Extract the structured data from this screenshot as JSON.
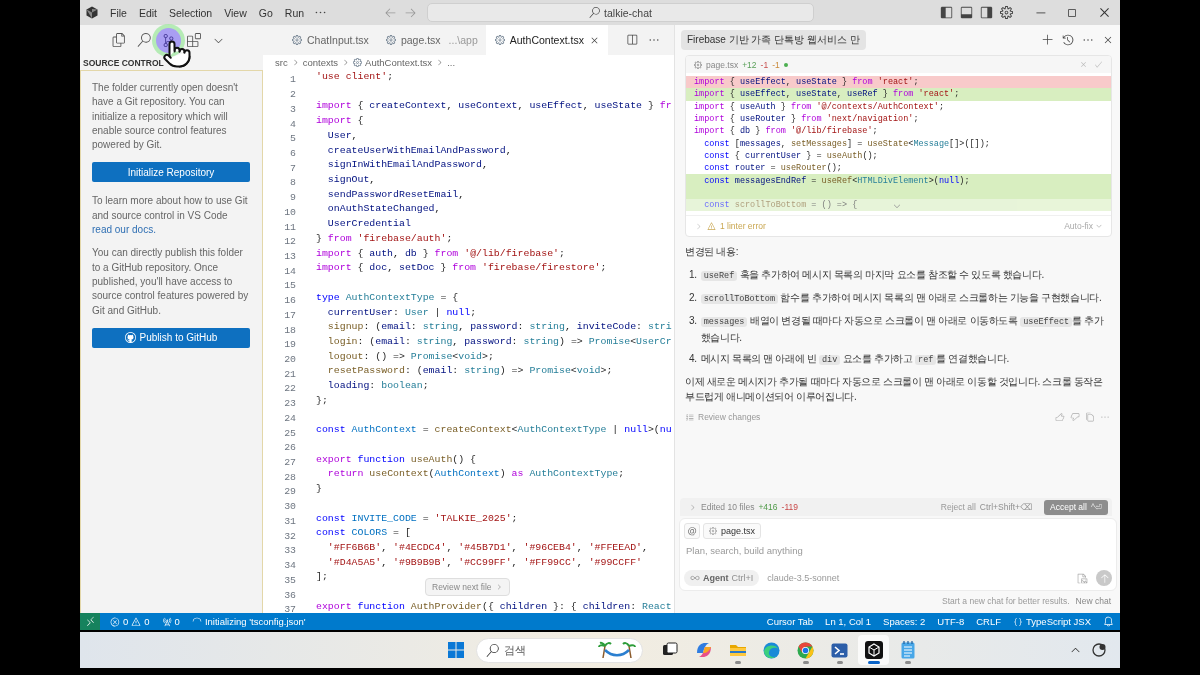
{
  "title_bar": {
    "menus": [
      "File",
      "Edit",
      "Selection",
      "View",
      "Go",
      "Run"
    ],
    "search": "talkie-chat"
  },
  "sidebar": {
    "views": [
      {
        "kind": "explorer",
        "selected": false
      },
      {
        "kind": "search",
        "selected": false
      },
      {
        "kind": "source_control",
        "selected": true
      },
      {
        "kind": "extensions",
        "selected": false
      },
      {
        "kind": "more",
        "selected": false
      }
    ],
    "title": "SOURCE CONTROL",
    "intro": "The folder currently open doesn't have a Git repository. You can initialize a repository which will enable source control features powered by Git.",
    "init_button": "Initialize Repository",
    "docs_text": "To learn more about how to use Git and source control in VS Code",
    "docs_link": "read our docs.",
    "publish_text": "You can directly publish this folder to a GitHub repository. Once published, you'll have access to source control features powered by Git and GitHub.",
    "publish_button": "Publish to GitHub"
  },
  "editor": {
    "tabs": [
      {
        "label": "ChatInput.tsx",
        "selected": false
      },
      {
        "label": "page.tsx",
        "detail": "...\\app",
        "selected": false
      },
      {
        "label": "AuthContext.tsx",
        "selected": true
      }
    ],
    "breadcrumb": [
      "src",
      "contexts",
      "AuthContext.tsx",
      "..."
    ],
    "lines": [
      {
        "number": "1",
        "tokens": [
          {
            "kind": "string",
            "text": "'use client'"
          },
          {
            "kind": "plain",
            "text": ";"
          }
        ]
      },
      {
        "number": "2"
      },
      {
        "number": "3",
        "tokens": [
          {
            "kind": "control",
            "text": "import"
          },
          {
            "kind": "plain",
            "text": " { "
          },
          {
            "kind": "variable",
            "text": "createContext"
          },
          {
            "kind": "plain",
            "text": ", "
          },
          {
            "kind": "variable",
            "text": "useContext"
          },
          {
            "kind": "plain",
            "text": ", "
          },
          {
            "kind": "variable",
            "text": "useEffect"
          },
          {
            "kind": "plain",
            "text": ", "
          },
          {
            "kind": "variable",
            "text": "useState"
          },
          {
            "kind": "plain",
            "text": " } "
          },
          {
            "kind": "control",
            "text": "fr"
          }
        ]
      },
      {
        "number": "4",
        "tokens": [
          {
            "kind": "control",
            "text": "import"
          },
          {
            "kind": "plain",
            "text": " {"
          }
        ]
      },
      {
        "number": "5",
        "tokens": [
          {
            "kind": "variable",
            "text": "  User"
          },
          {
            "kind": "plain",
            "text": ","
          }
        ]
      },
      {
        "number": "6",
        "tokens": [
          {
            "kind": "variable",
            "text": "  createUserWithEmailAndPassword"
          },
          {
            "kind": "plain",
            "text": ","
          }
        ]
      },
      {
        "number": "7",
        "tokens": [
          {
            "kind": "variable",
            "text": "  signInWithEmailAndPassword"
          },
          {
            "kind": "plain",
            "text": ","
          }
        ]
      },
      {
        "number": "8",
        "tokens": [
          {
            "kind": "variable",
            "text": "  signOut"
          },
          {
            "kind": "plain",
            "text": ","
          }
        ]
      },
      {
        "number": "9",
        "tokens": [
          {
            "kind": "variable",
            "text": "  sendPasswordResetEmail"
          },
          {
            "kind": "plain",
            "text": ","
          }
        ]
      },
      {
        "number": "10",
        "tokens": [
          {
            "kind": "variable",
            "text": "  onAuthStateChanged"
          },
          {
            "kind": "plain",
            "text": ","
          }
        ]
      },
      {
        "number": "11",
        "tokens": [
          {
            "kind": "variable",
            "text": "  UserCredential"
          }
        ]
      },
      {
        "number": "12",
        "tokens": [
          {
            "kind": "plain",
            "text": "} "
          },
          {
            "kind": "control",
            "text": "from"
          },
          {
            "kind": "string",
            "text": " 'firebase/auth'"
          },
          {
            "kind": "plain",
            "text": ";"
          }
        ]
      },
      {
        "number": "13",
        "tokens": [
          {
            "kind": "control",
            "text": "import"
          },
          {
            "kind": "plain",
            "text": " { "
          },
          {
            "kind": "variable",
            "text": "auth"
          },
          {
            "kind": "plain",
            "text": ", "
          },
          {
            "kind": "variable",
            "text": "db"
          },
          {
            "kind": "plain",
            "text": " } "
          },
          {
            "kind": "control",
            "text": "from"
          },
          {
            "kind": "string",
            "text": " '@/lib/firebase'"
          },
          {
            "kind": "plain",
            "text": ";"
          }
        ]
      },
      {
        "number": "14",
        "tokens": [
          {
            "kind": "control",
            "text": "import"
          },
          {
            "kind": "plain",
            "text": " { "
          },
          {
            "kind": "variable",
            "text": "doc"
          },
          {
            "kind": "plain",
            "text": ", "
          },
          {
            "kind": "variable",
            "text": "setDoc"
          },
          {
            "kind": "plain",
            "text": " } "
          },
          {
            "kind": "control",
            "text": "from"
          },
          {
            "kind": "string",
            "text": " 'firebase/firestore'"
          },
          {
            "kind": "plain",
            "text": ";"
          }
        ]
      },
      {
        "number": "15"
      },
      {
        "number": "16",
        "tokens": [
          {
            "kind": "keyword",
            "text": "type"
          },
          {
            "kind": "type",
            "text": " AuthContextType"
          },
          {
            "kind": "plain",
            "text": " = {"
          }
        ]
      },
      {
        "number": "17",
        "tokens": [
          {
            "kind": "variable",
            "text": "  currentUser"
          },
          {
            "kind": "plain",
            "text": ": "
          },
          {
            "kind": "type",
            "text": "User"
          },
          {
            "kind": "plain",
            "text": " | "
          },
          {
            "kind": "keyword",
            "text": "null"
          },
          {
            "kind": "plain",
            "text": ";"
          }
        ]
      },
      {
        "number": "18",
        "tokens": [
          {
            "kind": "function",
            "text": "  signup"
          },
          {
            "kind": "plain",
            "text": ": ("
          },
          {
            "kind": "variable",
            "text": "email"
          },
          {
            "kind": "plain",
            "text": ": "
          },
          {
            "kind": "type",
            "text": "string"
          },
          {
            "kind": "plain",
            "text": ", "
          },
          {
            "kind": "variable",
            "text": "password"
          },
          {
            "kind": "plain",
            "text": ": "
          },
          {
            "kind": "type",
            "text": "string"
          },
          {
            "kind": "plain",
            "text": ", "
          },
          {
            "kind": "variable",
            "text": "inviteCode"
          },
          {
            "kind": "plain",
            "text": ": "
          },
          {
            "kind": "type",
            "text": "stri"
          }
        ]
      },
      {
        "number": "19",
        "tokens": [
          {
            "kind": "function",
            "text": "  login"
          },
          {
            "kind": "plain",
            "text": ": ("
          },
          {
            "kind": "variable",
            "text": "email"
          },
          {
            "kind": "plain",
            "text": ": "
          },
          {
            "kind": "type",
            "text": "string"
          },
          {
            "kind": "plain",
            "text": ", "
          },
          {
            "kind": "variable",
            "text": "password"
          },
          {
            "kind": "plain",
            "text": ": "
          },
          {
            "kind": "type",
            "text": "string"
          },
          {
            "kind": "plain",
            "text": ") => "
          },
          {
            "kind": "type",
            "text": "Promise"
          },
          {
            "kind": "plain",
            "text": "<"
          },
          {
            "kind": "type",
            "text": "UserCr"
          }
        ]
      },
      {
        "number": "20",
        "tokens": [
          {
            "kind": "function",
            "text": "  logout"
          },
          {
            "kind": "plain",
            "text": ": () => "
          },
          {
            "kind": "type",
            "text": "Promise"
          },
          {
            "kind": "plain",
            "text": "<"
          },
          {
            "kind": "type",
            "text": "void"
          },
          {
            "kind": "plain",
            "text": ">;"
          }
        ]
      },
      {
        "number": "21",
        "tokens": [
          {
            "kind": "function",
            "text": "  resetPassword"
          },
          {
            "kind": "plain",
            "text": ": ("
          },
          {
            "kind": "variable",
            "text": "email"
          },
          {
            "kind": "plain",
            "text": ": "
          },
          {
            "kind": "type",
            "text": "string"
          },
          {
            "kind": "plain",
            "text": ") => "
          },
          {
            "kind": "type",
            "text": "Promise"
          },
          {
            "kind": "plain",
            "text": "<"
          },
          {
            "kind": "type",
            "text": "void"
          },
          {
            "kind": "plain",
            "text": ">;"
          }
        ]
      },
      {
        "number": "22",
        "tokens": [
          {
            "kind": "variable",
            "text": "  loading"
          },
          {
            "kind": "plain",
            "text": ": "
          },
          {
            "kind": "type",
            "text": "boolean"
          },
          {
            "kind": "plain",
            "text": ";"
          }
        ]
      },
      {
        "number": "23",
        "tokens": [
          {
            "kind": "plain",
            "text": "};"
          }
        ]
      },
      {
        "number": "24"
      },
      {
        "number": "25",
        "tokens": [
          {
            "kind": "keyword",
            "text": "const"
          },
          {
            "kind": "constant",
            "text": " AuthContext"
          },
          {
            "kind": "plain",
            "text": " = "
          },
          {
            "kind": "function",
            "text": "createContext"
          },
          {
            "kind": "plain",
            "text": "<"
          },
          {
            "kind": "type",
            "text": "AuthContextType"
          },
          {
            "kind": "plain",
            "text": " | "
          },
          {
            "kind": "keyword",
            "text": "null"
          },
          {
            "kind": "plain",
            "text": ">("
          },
          {
            "kind": "keyword",
            "text": "nu"
          }
        ]
      },
      {
        "number": "26"
      },
      {
        "number": "27",
        "tokens": [
          {
            "kind": "control",
            "text": "export"
          },
          {
            "kind": "keyword",
            "text": " function"
          },
          {
            "kind": "function",
            "text": " useAuth"
          },
          {
            "kind": "plain",
            "text": "() {"
          }
        ]
      },
      {
        "number": "28",
        "tokens": [
          {
            "kind": "control",
            "text": "  return"
          },
          {
            "kind": "function",
            "text": " useContext"
          },
          {
            "kind": "plain",
            "text": "("
          },
          {
            "kind": "constant",
            "text": "AuthContext"
          },
          {
            "kind": "plain",
            "text": ") "
          },
          {
            "kind": "control",
            "text": "as"
          },
          {
            "kind": "type",
            "text": " AuthContextType"
          },
          {
            "kind": "plain",
            "text": ";"
          }
        ]
      },
      {
        "number": "29",
        "tokens": [
          {
            "kind": "plain",
            "text": "}"
          }
        ]
      },
      {
        "number": "30"
      },
      {
        "number": "31",
        "tokens": [
          {
            "kind": "keyword",
            "text": "const"
          },
          {
            "kind": "constant",
            "text": " INVITE_CODE"
          },
          {
            "kind": "plain",
            "text": " = "
          },
          {
            "kind": "string",
            "text": "'TALKIE_2025'"
          },
          {
            "kind": "plain",
            "text": ";"
          }
        ]
      },
      {
        "number": "32",
        "tokens": [
          {
            "kind": "keyword",
            "text": "const"
          },
          {
            "kind": "constant",
            "text": " COLORS"
          },
          {
            "kind": "plain",
            "text": " = ["
          }
        ]
      },
      {
        "number": "33",
        "tokens": [
          {
            "kind": "string",
            "text": "  '#FF6B6B'"
          },
          {
            "kind": "plain",
            "text": ", "
          },
          {
            "kind": "string",
            "text": "'#4ECDC4'"
          },
          {
            "kind": "plain",
            "text": ", "
          },
          {
            "kind": "string",
            "text": "'#45B7D1'"
          },
          {
            "kind": "plain",
            "text": ", "
          },
          {
            "kind": "string",
            "text": "'#96CEB4'"
          },
          {
            "kind": "plain",
            "text": ", "
          },
          {
            "kind": "string",
            "text": "'#FFEEAD'"
          },
          {
            "kind": "plain",
            "text": ","
          }
        ]
      },
      {
        "number": "34",
        "tokens": [
          {
            "kind": "string",
            "text": "  '#D4A5A5'"
          },
          {
            "kind": "plain",
            "text": ", "
          },
          {
            "kind": "string",
            "text": "'#9B9B9B'"
          },
          {
            "kind": "plain",
            "text": ", "
          },
          {
            "kind": "string",
            "text": "'#CC99FF'"
          },
          {
            "kind": "plain",
            "text": ", "
          },
          {
            "kind": "string",
            "text": "'#FF99CC'"
          },
          {
            "kind": "plain",
            "text": ", "
          },
          {
            "kind": "string",
            "text": "'#99CCFF'"
          }
        ]
      },
      {
        "number": "35",
        "tokens": [
          {
            "kind": "plain",
            "text": "];"
          }
        ]
      },
      {
        "number": "36"
      },
      {
        "number": "37",
        "tokens": [
          {
            "kind": "control",
            "text": "export"
          },
          {
            "kind": "keyword",
            "text": " function"
          },
          {
            "kind": "function",
            "text": " AuthProvider"
          },
          {
            "kind": "plain",
            "text": "({ "
          },
          {
            "kind": "variable",
            "text": "children"
          },
          {
            "kind": "plain",
            "text": " }: { "
          },
          {
            "kind": "variable",
            "text": "children"
          },
          {
            "kind": "plain",
            "text": ": "
          },
          {
            "kind": "type",
            "text": "React"
          }
        ]
      }
    ],
    "review_button": "Review next file"
  },
  "chat": {
    "tab": "Firebase 기반 가족 단톡방 웹서비스 만",
    "diff": {
      "file": "page.tsx",
      "stats": [
        {
          "kind": "added",
          "text": "+12"
        },
        {
          "kind": "removed",
          "text": "-1"
        },
        {
          "kind": "pending",
          "text": "-1"
        }
      ],
      "modified": true,
      "lines": [
        {
          "kind": "removed",
          "tokens": [
            {
              "kind": "control",
              "text": "import"
            },
            {
              "kind": "plain",
              "text": " { "
            },
            {
              "kind": "variable",
              "text": "useEffect"
            },
            {
              "kind": "plain",
              "text": ", "
            },
            {
              "kind": "variable",
              "text": "useState"
            },
            {
              "kind": "plain",
              "text": " } "
            },
            {
              "kind": "control",
              "text": "from"
            },
            {
              "kind": "string",
              "text": " 'react'"
            },
            {
              "kind": "plain",
              "text": ";"
            }
          ]
        },
        {
          "kind": "added",
          "tokens": [
            {
              "kind": "control",
              "text": "import"
            },
            {
              "kind": "plain",
              "text": " { "
            },
            {
              "kind": "variable",
              "text": "useEffect"
            },
            {
              "kind": "plain",
              "text": ", "
            },
            {
              "kind": "variable",
              "text": "useState"
            },
            {
              "kind": "plain",
              "text": ", "
            },
            {
              "kind": "variable",
              "text": "useRef"
            },
            {
              "kind": "plain",
              "text": " } "
            },
            {
              "kind": "control",
              "text": "from"
            },
            {
              "kind": "string",
              "text": " 'react'"
            },
            {
              "kind": "plain",
              "text": ";"
            }
          ]
        },
        {
          "kind": "context",
          "tokens": [
            {
              "kind": "control",
              "text": "import"
            },
            {
              "kind": "plain",
              "text": " { "
            },
            {
              "kind": "variable",
              "text": "useAuth"
            },
            {
              "kind": "plain",
              "text": " } "
            },
            {
              "kind": "control",
              "text": "from"
            },
            {
              "kind": "string",
              "text": " '@/contexts/AuthContext'"
            },
            {
              "kind": "plain",
              "text": ";"
            }
          ]
        },
        {
          "kind": "context",
          "tokens": [
            {
              "kind": "control",
              "text": "import"
            },
            {
              "kind": "plain",
              "text": " { "
            },
            {
              "kind": "variable",
              "text": "useRouter"
            },
            {
              "kind": "plain",
              "text": " } "
            },
            {
              "kind": "control",
              "text": "from"
            },
            {
              "kind": "string",
              "text": " 'next/navigation'"
            },
            {
              "kind": "plain",
              "text": ";"
            }
          ]
        },
        {
          "kind": "context",
          "tokens": [
            {
              "kind": "control",
              "text": "import"
            },
            {
              "kind": "plain",
              "text": " { "
            },
            {
              "kind": "variable",
              "text": "db"
            },
            {
              "kind": "plain",
              "text": " } "
            },
            {
              "kind": "control",
              "text": "from"
            },
            {
              "kind": "string",
              "text": " '@/lib/firebase'"
            },
            {
              "kind": "plain",
              "text": ";"
            }
          ]
        },
        {
          "kind": "context",
          "tokens": [
            {
              "kind": "keyword",
              "text": "  const"
            },
            {
              "kind": "plain",
              "text": " ["
            },
            {
              "kind": "variable",
              "text": "messages"
            },
            {
              "kind": "plain",
              "text": ", "
            },
            {
              "kind": "function",
              "text": "setMessages"
            },
            {
              "kind": "plain",
              "text": "] = "
            },
            {
              "kind": "function",
              "text": "useState"
            },
            {
              "kind": "plain",
              "text": "<"
            },
            {
              "kind": "type",
              "text": "Message"
            },
            {
              "kind": "plain",
              "text": "[]>([]);"
            }
          ]
        },
        {
          "kind": "context",
          "tokens": [
            {
              "kind": "keyword",
              "text": "  const"
            },
            {
              "kind": "plain",
              "text": " { "
            },
            {
              "kind": "variable",
              "text": "currentUser"
            },
            {
              "kind": "plain",
              "text": " } = "
            },
            {
              "kind": "function",
              "text": "useAuth"
            },
            {
              "kind": "plain",
              "text": "();"
            }
          ]
        },
        {
          "kind": "context",
          "tokens": [
            {
              "kind": "keyword",
              "text": "  const"
            },
            {
              "kind": "variable",
              "text": " router"
            },
            {
              "kind": "plain",
              "text": " = "
            },
            {
              "kind": "function",
              "text": "useRouter"
            },
            {
              "kind": "plain",
              "text": "();"
            }
          ]
        },
        {
          "kind": "added",
          "tokens": [
            {
              "kind": "keyword",
              "text": "  const"
            },
            {
              "kind": "variable",
              "text": " messagesEndRef"
            },
            {
              "kind": "plain",
              "text": " = "
            },
            {
              "kind": "function",
              "text": "useRef"
            },
            {
              "kind": "plain",
              "text": "<"
            },
            {
              "kind": "type",
              "text": "HTMLDivElement"
            },
            {
              "kind": "plain",
              "text": ">("
            },
            {
              "kind": "keyword",
              "text": "null"
            },
            {
              "kind": "plain",
              "text": ");"
            }
          ]
        },
        {
          "kind": "added"
        },
        {
          "kind": "added",
          "tokens": [
            {
              "kind": "keyword",
              "text": "  const"
            },
            {
              "kind": "function",
              "text": " scrollToBottom"
            },
            {
              "kind": "plain",
              "text": " = () => {"
            }
          ]
        }
      ],
      "collapsed": true,
      "lint": "1 linter error",
      "fix": "Auto-fix"
    },
    "heading": "변경된 내용:",
    "steps": [
      {
        "number": "1.",
        "parts": [
          {
            "kind": "code",
            "text": "useRef"
          },
          {
            "kind": "text",
            "text": " 훅을 추가하여 메시지 목록의 마지막 요소를 참조할 수 있도록 했습니다."
          }
        ]
      },
      {
        "number": "2.",
        "parts": [
          {
            "kind": "code",
            "text": "scrollToBottom"
          },
          {
            "kind": "text",
            "text": " 함수를 추가하여 메시지 목록의 맨 아래로 스크롤하는 기능을 구현했습니다."
          }
        ]
      },
      {
        "number": "3.",
        "parts": [
          {
            "kind": "code",
            "text": "messages"
          },
          {
            "kind": "text",
            "text": " 배열이 변경될 때마다 자동으로 스크롤이 맨 아래로 이동하도록 "
          },
          {
            "kind": "code",
            "text": "useEffect"
          },
          {
            "kind": "text",
            "text": "를 추가했습니다."
          }
        ]
      },
      {
        "number": "4.",
        "parts": [
          {
            "kind": "text",
            "text": "메시지 목록의 맨 아래에 빈 "
          },
          {
            "kind": "code",
            "text": "div"
          },
          {
            "kind": "text",
            "text": " 요소를 추가하고 "
          },
          {
            "kind": "code",
            "text": "ref"
          },
          {
            "kind": "text",
            "text": "를 연결했습니다."
          }
        ]
      }
    ],
    "summary": "이제 새로운 메시지가 추가될 때마다 자동으로 스크롤이 맨 아래로 이동할 것입니다. 스크롤 동작은 부드럽게 애니메이션되어 이루어집니다.",
    "review": "Review changes",
    "edits": {
      "summary": "Edited 10 files",
      "added": "+416",
      "removed": "-119"
    },
    "reject": {
      "label": "Reject all",
      "shortcut": "Ctrl+Shift+⌫"
    },
    "accept": {
      "label": "Accept all",
      "shortcut": "^⏎"
    },
    "context_chip": "page.tsx",
    "placeholder": "Plan, search, build anything",
    "mode": {
      "label": "Agent",
      "shortcut": "Ctrl+I"
    },
    "model": "claude-3.5-sonnet",
    "hint": "Start a new chat for better results.",
    "new_chat": "New chat"
  },
  "status_bar": {
    "errors": "0",
    "warnings": "0",
    "ports": "0",
    "task": "Initializing 'tsconfig.json'",
    "items": [
      "Cursor Tab",
      "Ln 1, Col 1",
      "Spaces: 2",
      "UTF-8",
      "CRLF"
    ],
    "language": "TypeScript JSX"
  },
  "taskbar": {
    "search_label": "검색",
    "apps": [
      {
        "kind": "task_view",
        "running": false,
        "selected": false
      },
      {
        "kind": "copilot",
        "running": false,
        "selected": false
      },
      {
        "kind": "explorer",
        "running": true,
        "selected": false
      },
      {
        "kind": "edge",
        "running": false,
        "selected": false
      },
      {
        "kind": "chrome",
        "running": true,
        "selected": false
      },
      {
        "kind": "terminal",
        "running": true,
        "selected": false
      },
      {
        "kind": "cursor",
        "running": true,
        "selected": true
      },
      {
        "kind": "notepad",
        "running": true,
        "selected": false
      }
    ]
  }
}
